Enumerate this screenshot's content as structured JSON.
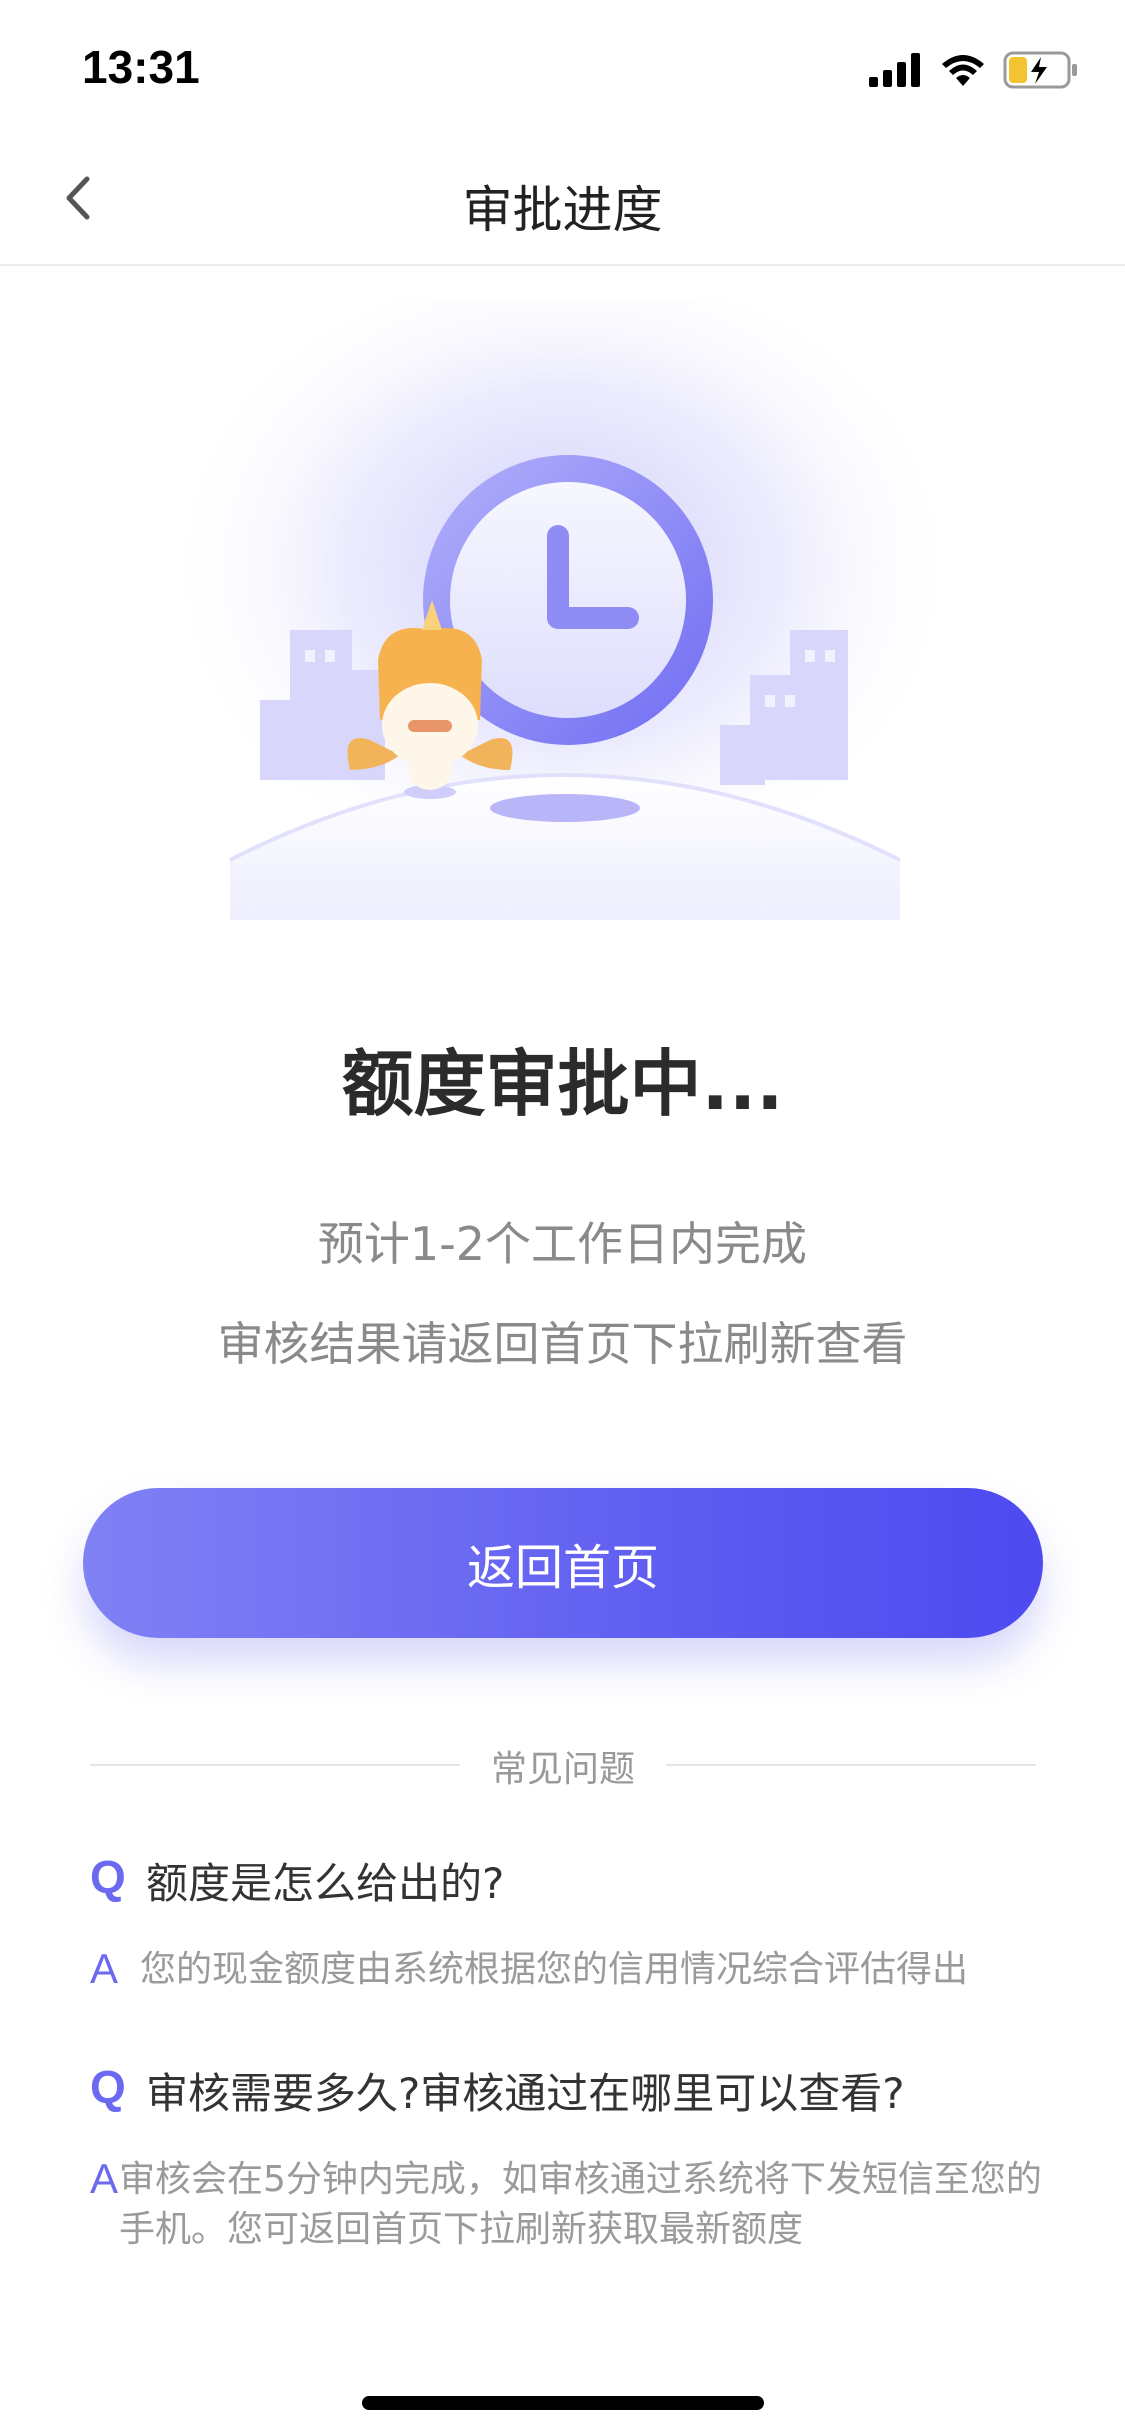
{
  "status_bar": {
    "time": "13:31"
  },
  "nav": {
    "title": "审批进度"
  },
  "status": {
    "title": "额度审批中...",
    "line1": "预计1-2个工作日内完成",
    "line2": "审核结果请返回首页下拉刷新查看"
  },
  "button": {
    "label": "返回首页"
  },
  "faq": {
    "heading": "常见问题",
    "q_mark": "Q",
    "a_mark": "A",
    "items": [
      {
        "q": "额度是怎么给出的?",
        "a": "您的现金额度由系统根据您的信用情况综合评估得出"
      },
      {
        "q": "审核需要多久?审核通过在哪里可以查看?",
        "a": "审核会在5分钟内完成，如审核通过系统将下发短信至您的手机。您可返回首页下拉刷新获取最新额度"
      }
    ]
  },
  "colors": {
    "accent": "#5a58f0",
    "accent_light": "#8181f5",
    "text_muted": "#8a8a8a"
  },
  "icons": [
    "back-arrow-icon",
    "signal-icon",
    "wifi-icon",
    "battery-charging-icon",
    "clock-illustration",
    "mascot-illustration"
  ]
}
